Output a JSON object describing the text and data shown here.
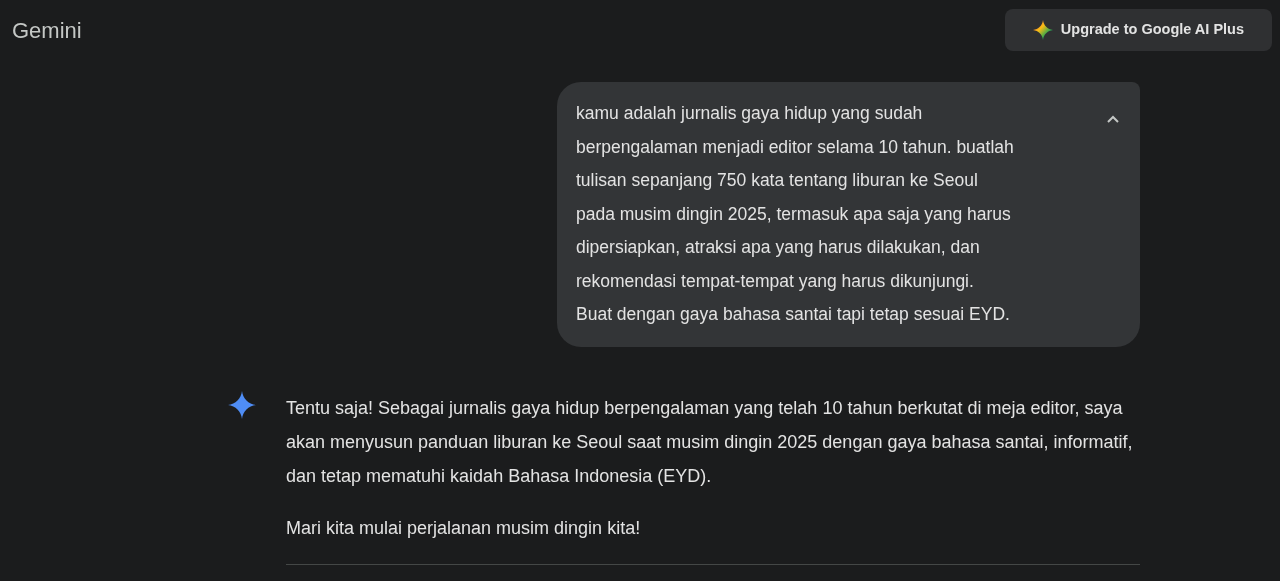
{
  "header": {
    "title": "Gemini",
    "upgrade_button": "Upgrade to Google AI Plus"
  },
  "user_message": {
    "expanded": true,
    "lines": [
      "kamu adalah jurnalis gaya hidup yang sudah",
      "berpengalaman menjadi editor selama 10 tahun. buatlah",
      "tulisan sepanjang 750 kata tentang liburan ke Seoul",
      "pada musim dingin 2025, termasuk apa saja yang harus",
      "dipersiapkan, atraksi apa yang harus dilakukan, dan",
      "rekomendasi tempat-tempat yang harus dikunjungi.",
      "Buat dengan gaya bahasa santai tapi tetap sesuai EYD."
    ]
  },
  "response": {
    "paragraphs": [
      "Tentu saja! Sebagai jurnalis gaya hidup berpengalaman yang telah 10 tahun berkutat di meja editor, saya akan menyusun panduan liburan ke Seoul saat musim dingin 2025 dengan gaya bahasa santai, informatif, dan tetap mematuhi kaidah Bahasa Indonesia (EYD).",
      "Mari kita mulai perjalanan musim dingin kita!"
    ]
  }
}
